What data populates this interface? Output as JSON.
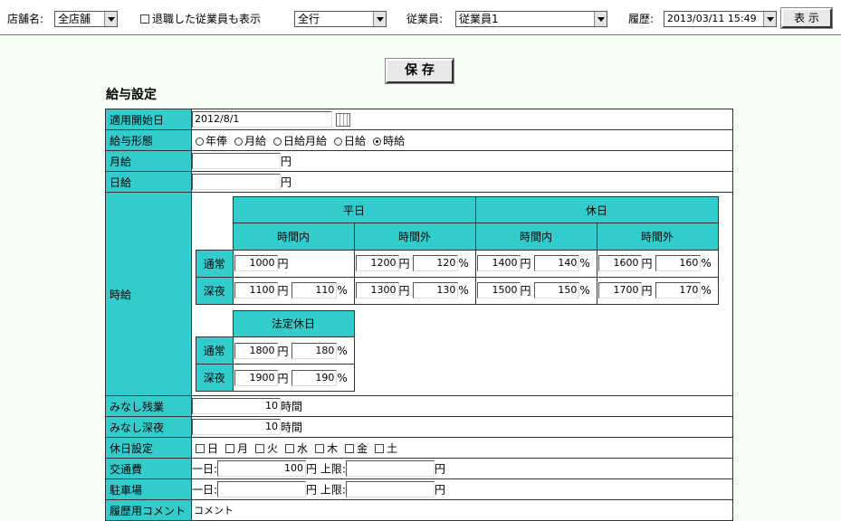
{
  "toolbar": {
    "store_label": "店舗名:",
    "store_value": "全店舗",
    "retired_label": "退職した従業員も表示",
    "row_select_value": "全行",
    "employee_label": "従業員:",
    "employee_value": "従業員1",
    "history_label": "履歴:",
    "history_value": "2013/03/11 15:49",
    "show_button": "表 示"
  },
  "save_button": "保 存",
  "section_title": "給与設定",
  "form": {
    "start_date": {
      "label": "適用開始日",
      "value": "2012/8/1"
    },
    "pay_type": {
      "label": "給与形態",
      "options": [
        "年俸",
        "月給",
        "日給月給",
        "日給",
        "時給"
      ],
      "selected": "時給"
    },
    "monthly": {
      "label": "月給",
      "value": "",
      "unit": "円"
    },
    "daily": {
      "label": "日給",
      "value": "",
      "unit": "円"
    },
    "hourly": {
      "label": "時給",
      "weekday_header": "平日",
      "holiday_header": "休日",
      "in_hours": "時間内",
      "overtime": "時間外",
      "normal_label": "通常",
      "night_label": "深夜",
      "yen": "円",
      "pct": "%",
      "weekday_in_normal": "1000",
      "weekday_in_night": "1100",
      "weekday_in_night_pct": "110",
      "weekday_out_normal": "1200",
      "weekday_out_normal_pct": "120",
      "weekday_out_night": "1300",
      "weekday_out_night_pct": "130",
      "holiday_in_normal": "1400",
      "holiday_in_normal_pct": "140",
      "holiday_in_night": "1500",
      "holiday_in_night_pct": "150",
      "holiday_out_normal": "1600",
      "holiday_out_normal_pct": "160",
      "holiday_out_night": "1700",
      "holiday_out_night_pct": "170",
      "legal_holiday_header": "法定休日",
      "legal_normal": "1800",
      "legal_normal_pct": "180",
      "legal_night": "1900",
      "legal_night_pct": "190"
    },
    "deemed_overtime": {
      "label": "みなし残業",
      "value": "10",
      "unit": "時間"
    },
    "deemed_night": {
      "label": "みなし深夜",
      "value": "10",
      "unit": "時間"
    },
    "holiday_setting": {
      "label": "休日設定",
      "days": [
        "日",
        "月",
        "火",
        "水",
        "木",
        "金",
        "土"
      ]
    },
    "transport": {
      "label": "交通費",
      "per_day_label": "一日:",
      "value": "100",
      "unit": "円",
      "limit_label": "上限:",
      "limit_value": ""
    },
    "parking": {
      "label": "駐車場",
      "per_day_label": "一日:",
      "value": "",
      "unit": "円",
      "limit_label": "上限:",
      "limit_value": ""
    },
    "history_comment": {
      "label": "履歴用コメント",
      "value": "コメント"
    }
  }
}
